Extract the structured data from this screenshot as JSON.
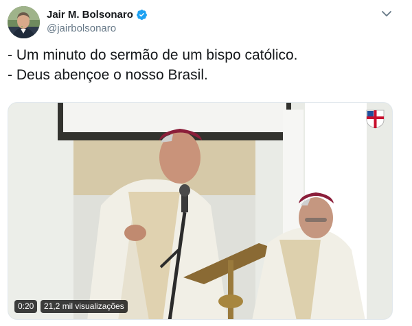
{
  "author": {
    "display_name": "Jair M. Bolsonaro",
    "handle": "@jairbolsonaro",
    "verified": true
  },
  "tweet": {
    "text": "- Um minuto do sermão de um bispo católico.\n- Deus abençoe o nosso Brasil."
  },
  "video": {
    "duration": "0:20",
    "views": "21,2 mil visualizações"
  },
  "icons": {
    "verified": "verified-badge-icon",
    "menu": "chevron-down-icon",
    "channel": "episcopal-flag-icon"
  },
  "colors": {
    "verified_blue": "#1da1f2",
    "text_primary": "#14171a",
    "text_secondary": "#657786"
  }
}
